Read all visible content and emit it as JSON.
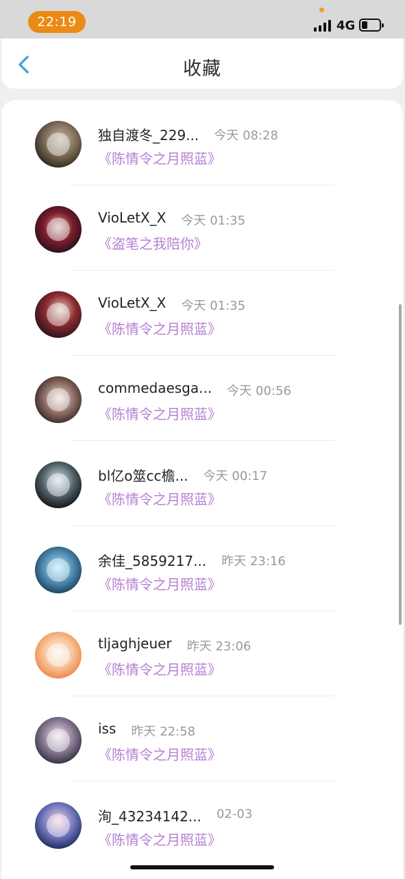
{
  "status_bar": {
    "time": "22:19",
    "network": "4G",
    "battery_icon": "battery-icon",
    "signal_icon": "signal-icon"
  },
  "header": {
    "title": "收藏",
    "back_icon": "chevron-left-icon"
  },
  "colors": {
    "accent": "#ea8b16",
    "link_purple": "#b57fd4",
    "back_blue": "#46a6df"
  },
  "items": [
    {
      "name": "独自渡冬_229...",
      "time": "今天 08:28",
      "subtitle": "《陈情令之月照蓝》"
    },
    {
      "name": "VioLetX_X",
      "time": "今天 01:35",
      "subtitle": "《盗笔之我陪你》"
    },
    {
      "name": "VioLetX_X",
      "time": "今天 01:35",
      "subtitle": "《陈情令之月照蓝》"
    },
    {
      "name": "commedaesga...",
      "time": "今天 00:56",
      "subtitle": "《陈情令之月照蓝》"
    },
    {
      "name": "bl亿o筮cc檐...",
      "time": "今天 00:17",
      "subtitle": "《陈情令之月照蓝》"
    },
    {
      "name": "余佳_5859217...",
      "time": "昨天 23:16",
      "subtitle": "《陈情令之月照蓝》"
    },
    {
      "name": "tljaghjeuer",
      "time": "昨天 23:06",
      "subtitle": "《陈情令之月照蓝》"
    },
    {
      "name": "iss",
      "time": "昨天 22:58",
      "subtitle": "《陈情令之月照蓝》"
    },
    {
      "name": "洵_43234142...",
      "time": "02-03",
      "subtitle": "《陈情令之月照蓝》"
    }
  ]
}
